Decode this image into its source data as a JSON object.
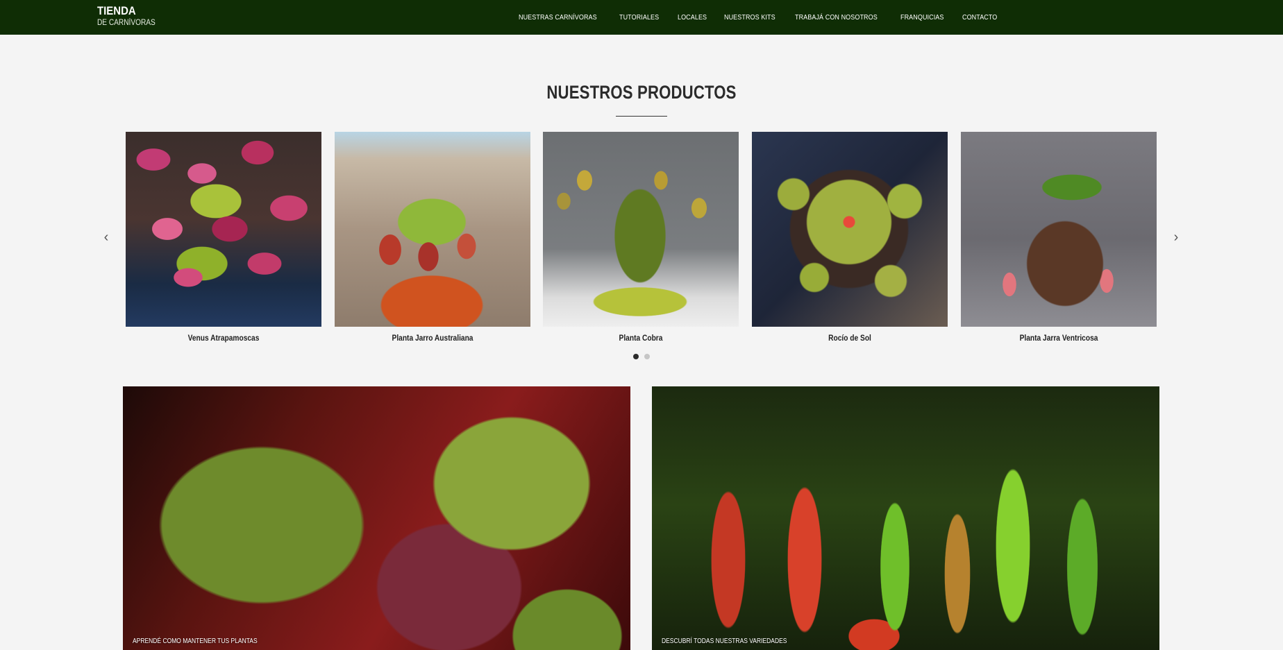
{
  "header": {
    "brand_title": "TIENDA",
    "brand_subtitle": "DE CARNÍVORAS",
    "background_color": "#0f2d05",
    "nav": [
      {
        "label": "NUESTRAS CARNÍVORAS"
      },
      {
        "label": "TUTORIALES"
      },
      {
        "label": "LOCALES"
      },
      {
        "label": "NUESTROS KITS"
      },
      {
        "label": "TRABAJÁ CON NOSOTROS"
      },
      {
        "label": "FRANQUICIAS"
      },
      {
        "label": "CONTACTO"
      }
    ]
  },
  "products": {
    "title": "NUESTROS PRODUCTOS",
    "prev_icon": "‹",
    "next_icon": "›",
    "items": [
      {
        "name": "Venus Atrapamoscas"
      },
      {
        "name": "Planta Jarro Australiana"
      },
      {
        "name": "Planta Cobra"
      },
      {
        "name": "Rocío de Sol"
      },
      {
        "name": "Planta Jarra Ventricosa"
      }
    ],
    "page_count": 2,
    "active_page": 1
  },
  "features": [
    {
      "caption": "APRENDÉ COMO MANTENER TUS PLANTAS"
    },
    {
      "caption": "DESCUBRÍ TODAS NUESTRAS VARIEDADES"
    }
  ]
}
